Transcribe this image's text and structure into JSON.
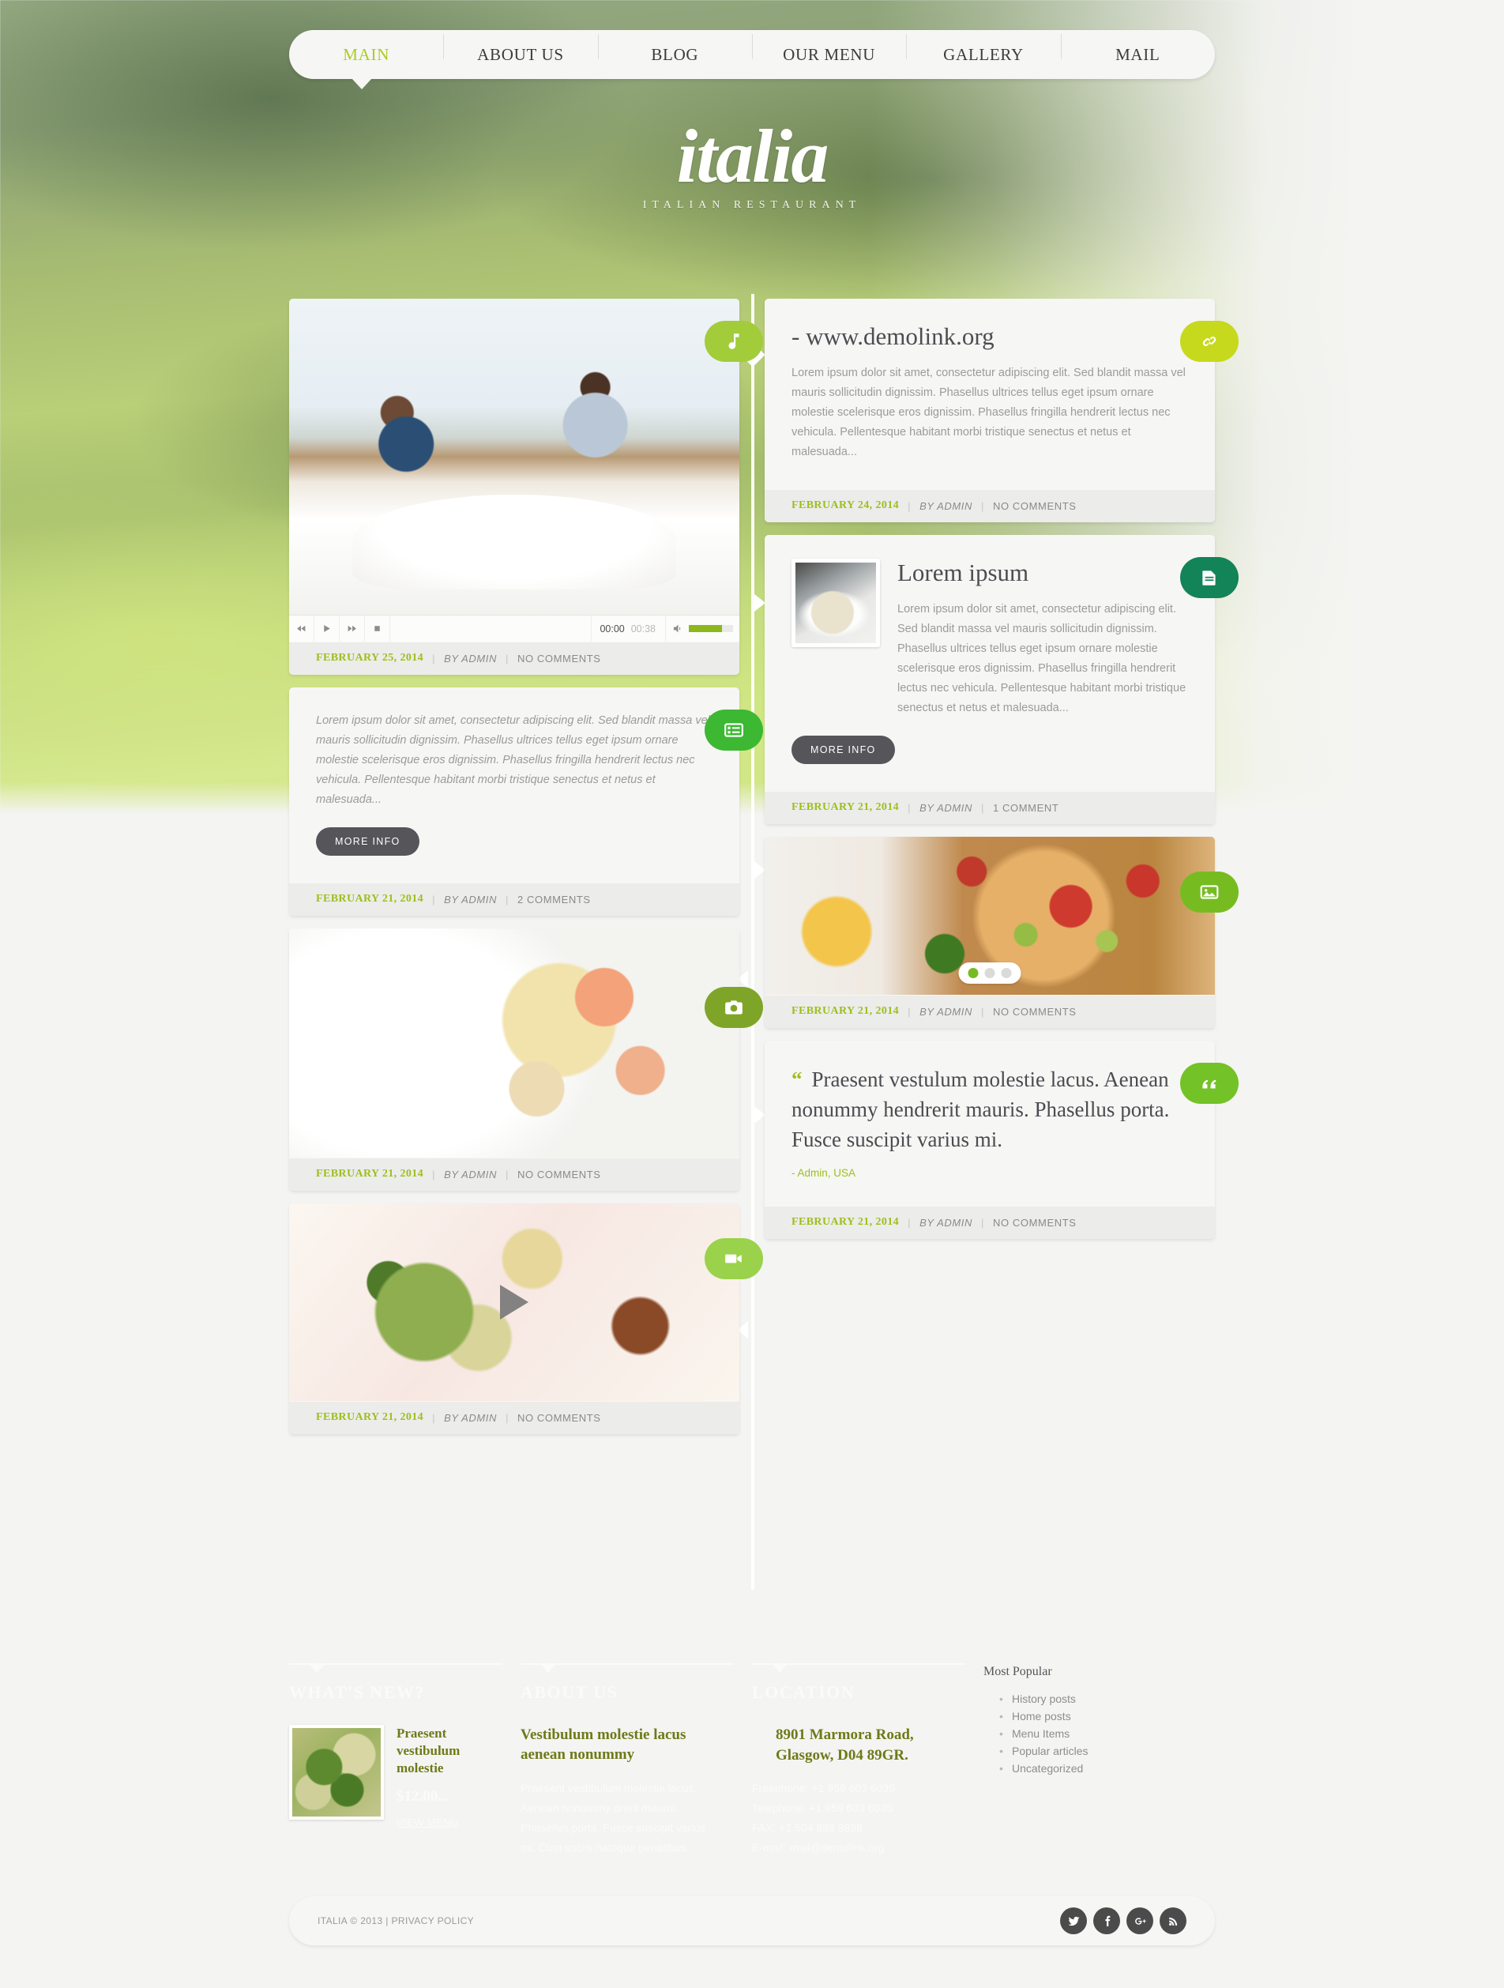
{
  "site": {
    "logo_script": "italia",
    "logo_sub": "ITALIAN RESTAURANT"
  },
  "nav": {
    "items": [
      {
        "label": "MAIN",
        "active": true
      },
      {
        "label": "ABOUT US",
        "active": false
      },
      {
        "label": "BLOG",
        "active": false
      },
      {
        "label": "OUR MENU",
        "active": false
      },
      {
        "label": "GALLERY",
        "active": false
      },
      {
        "label": "MAIL",
        "active": false
      }
    ]
  },
  "audio_player": {
    "prev_icon": "rewind-icon",
    "play_icon": "play-icon",
    "next_icon": "fast-forward-icon",
    "stop_icon": "stop-icon",
    "current_time": "00:00",
    "duration": "00:38",
    "volume_icon": "volume-icon"
  },
  "posts_left": [
    {
      "type": "audio",
      "badge_icon": "music-note-icon",
      "badge_color": "#a2cc3a",
      "date": "FEBRUARY 25, 2014",
      "by": "BY ADMIN",
      "comments": "NO COMMENTS"
    },
    {
      "type": "aside",
      "badge_icon": "list-icon",
      "badge_color": "#3cb832",
      "text": "Lorem ipsum dolor sit amet, consectetur adipiscing elit. Sed blandit massa vel mauris sollicitudin dignissim. Phasellus ultrices tellus eget ipsum ornare molestie scelerisque eros dignissim. Phasellus fringilla hendrerit lectus nec vehicula. Pellentesque habitant morbi tristique senectus et netus et malesuada...",
      "button": "MORE INFO",
      "date": "FEBRUARY 21, 2014",
      "by": "BY ADMIN",
      "comments": "2 COMMENTS"
    },
    {
      "type": "photo",
      "badge_icon": "camera-icon",
      "badge_color": "#7fa528",
      "date": "FEBRUARY 21, 2014",
      "by": "BY ADMIN",
      "comments": "NO COMMENTS"
    },
    {
      "type": "video",
      "badge_icon": "video-camera-icon",
      "badge_color": "#9ad24b",
      "date": "FEBRUARY 21, 2014",
      "by": "BY ADMIN",
      "comments": "NO COMMENTS"
    }
  ],
  "posts_right": [
    {
      "type": "link",
      "badge_icon": "link-icon",
      "badge_color": "#c6d91c",
      "title": "- www.demolink.org",
      "text": "Lorem ipsum dolor sit amet, consectetur adipiscing elit. Sed blandit massa vel mauris sollicitudin dignissim. Phasellus ultrices tellus eget ipsum ornare molestie scelerisque eros dignissim. Phasellus fringilla hendrerit lectus nec vehicula. Pellentesque habitant morbi tristique senectus et netus et malesuada...",
      "date": "FEBRUARY 24, 2014",
      "by": "BY ADMIN",
      "comments": "NO COMMENTS"
    },
    {
      "type": "standard",
      "badge_icon": "document-icon",
      "badge_color": "#128457",
      "title": "Lorem ipsum",
      "text": "Lorem ipsum dolor sit amet, consectetur adipiscing elit. Sed blandit massa vel mauris sollicitudin dignissim. Phasellus ultrices tellus eget ipsum ornare molestie scelerisque eros dignissim. Phasellus fringilla hendrerit lectus nec vehicula. Pellentesque habitant morbi tristique senectus et netus et malesuada...",
      "button": "MORE INFO",
      "date": "FEBRUARY 21, 2014",
      "by": "BY ADMIN",
      "comments": "1 COMMENT"
    },
    {
      "type": "gallery",
      "badge_icon": "image-icon",
      "badge_color": "#76bc21",
      "slider_dots": 3,
      "slider_active": 0,
      "date": "FEBRUARY 21, 2014",
      "by": "BY ADMIN",
      "comments": "NO COMMENTS"
    },
    {
      "type": "quote",
      "badge_icon": "quote-icon",
      "badge_color": "#73c227",
      "quote": "Praesent vestulum molestie lacus. Aenean nonummy hendrerit mauris. Phasellus porta. Fusce suscipit varius mi.",
      "quote_mark": "“",
      "author": "- Admin, USA",
      "date": "FEBRUARY 21, 2014",
      "by": "BY ADMIN",
      "comments": "NO COMMENTS"
    }
  ],
  "footer": {
    "whats_new": {
      "title": "WHAT'S NEW?",
      "post_title": "Praesent vestibulum molestie",
      "price": "$12.00...",
      "link": "VIEW MENU"
    },
    "about_us": {
      "title": "ABOUT US",
      "heading": "Vestibulum molestie lacus aenean nonummy",
      "text": "Praesent vestibulum molestie lacus. Aenean nonummy drerit mauris. Phasellus porta. Fusce suscipit varius mi. Cum sociis natoque penatibus."
    },
    "location": {
      "title": "LOCATION",
      "address": "8901 Marmora Road,\nGlasgow, D04 89GR.",
      "freephone": "Freephone: +1 959 603 6035",
      "telephone": "Telephone: +1 959 603 6035",
      "fax": "FAX: +1 504 889 9898",
      "email": "E-mail: mail@demolink.org"
    },
    "most_popular": {
      "title": "Most Popular",
      "items": [
        "History posts",
        "Home posts",
        "Menu Items",
        "Popular articles",
        "Uncategorized"
      ]
    },
    "copyright": "ITALIA © 2013 | PRIVACY POLICY",
    "socials": [
      {
        "name": "twitter-icon"
      },
      {
        "name": "facebook-icon"
      },
      {
        "name": "google-plus-icon"
      },
      {
        "name": "rss-icon"
      }
    ]
  },
  "colors": {
    "accent_lime": "#9dbf1c",
    "accent_green": "#76bc21",
    "dark_button": "#55555a"
  }
}
